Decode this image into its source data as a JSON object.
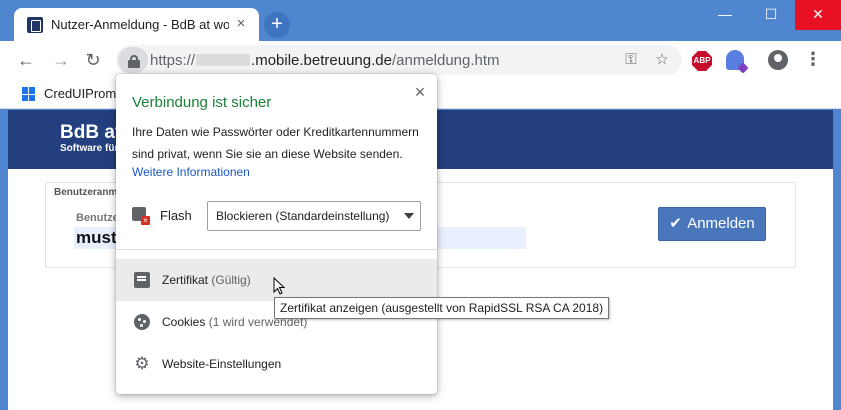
{
  "window": {
    "tab_title": "Nutzer-Anmeldung - BdB at work",
    "tab_close": "×",
    "new_tab": "+",
    "controls": {
      "minimize": "—",
      "maximize": "☐",
      "close": "✕"
    }
  },
  "toolbar": {
    "back": "←",
    "forward": "→",
    "reload": "↻",
    "url_scheme": "https://",
    "url_host": ".mobile.betreuung.de",
    "url_path": "/anmeldung.htm",
    "key": "⚿",
    "star": "☆",
    "abp": "ABP",
    "menu": "⋮"
  },
  "bookmarks": {
    "items": [
      {
        "label": "CredUIPromp"
      }
    ]
  },
  "page": {
    "brand_title": "BdB at",
    "brand_subtitle": "Software für",
    "legend": "Benutzeranm",
    "field_label": "Benutze",
    "username_value": "muste",
    "login_check": "✔",
    "login_label": "Anmelden"
  },
  "popup": {
    "title": "Verbindung ist sicher",
    "close": "×",
    "description": "Ihre Daten wie Passwörter oder Kreditkartennummern sind privat, wenn Sie sie an diese Website senden.",
    "more_info": "Weitere Informationen",
    "permission": {
      "label": "Flash",
      "value": "Blockieren (Standardeinstellung)"
    },
    "rows": {
      "certificate": {
        "label": "Zertifikat",
        "status": "(Gültig)"
      },
      "cookies": {
        "label": "Cookies",
        "status": "(1 wird verwendet)"
      },
      "site_settings": {
        "label": "Website-Einstellungen"
      }
    },
    "gear": "⚙"
  },
  "tooltip": {
    "text": "Zertifikat anzeigen (ausgestellt von RapidSSL RSA CA 2018)"
  },
  "colors": {
    "titlebar": "#4f86cf",
    "banner": "#233f7e",
    "secure_green": "#188038",
    "link_blue": "#1a57c5",
    "login_button": "#4a77bb"
  }
}
